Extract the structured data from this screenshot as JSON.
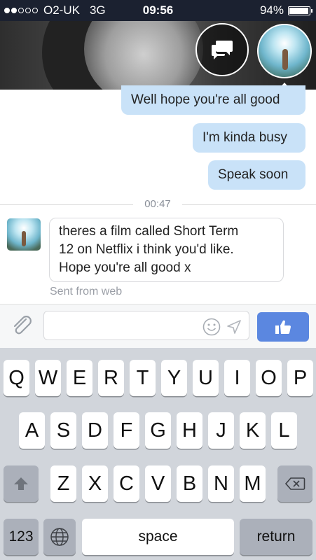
{
  "status_bar": {
    "signal_filled": 2,
    "signal_total": 5,
    "carrier": "O2-UK",
    "network": "3G",
    "time": "09:56",
    "battery": "94%",
    "battery_level": 0.94
  },
  "header": {
    "chat_heads_icon": "chat-bubbles-icon",
    "profile_icon": "profile-avatar"
  },
  "messages": {
    "outgoing": [
      "Well hope you're all good",
      "I'm kinda busy",
      "Speak soon"
    ],
    "timestamp": "00:47",
    "incoming": {
      "line1": "theres a film called Short Term",
      "line2": "12 on Netflix i think you'd like.",
      "line3": "Hope you're all good x",
      "footer": "Sent from web"
    }
  },
  "composer": {
    "value": "",
    "placeholder": "",
    "attach_icon": "paperclip-icon",
    "emoji_icon": "smiley-icon",
    "send_icon": "send-arrow-icon",
    "like_icon": "thumbs-up-icon",
    "accent": "#5b87e0"
  },
  "keyboard": {
    "row1": [
      "Q",
      "W",
      "E",
      "R",
      "T",
      "Y",
      "U",
      "I",
      "O",
      "P"
    ],
    "row2": [
      "A",
      "S",
      "D",
      "F",
      "G",
      "H",
      "J",
      "K",
      "L"
    ],
    "row3": [
      "Z",
      "X",
      "C",
      "V",
      "B",
      "N",
      "M"
    ],
    "numbers": "123",
    "space": "space",
    "return": "return"
  }
}
